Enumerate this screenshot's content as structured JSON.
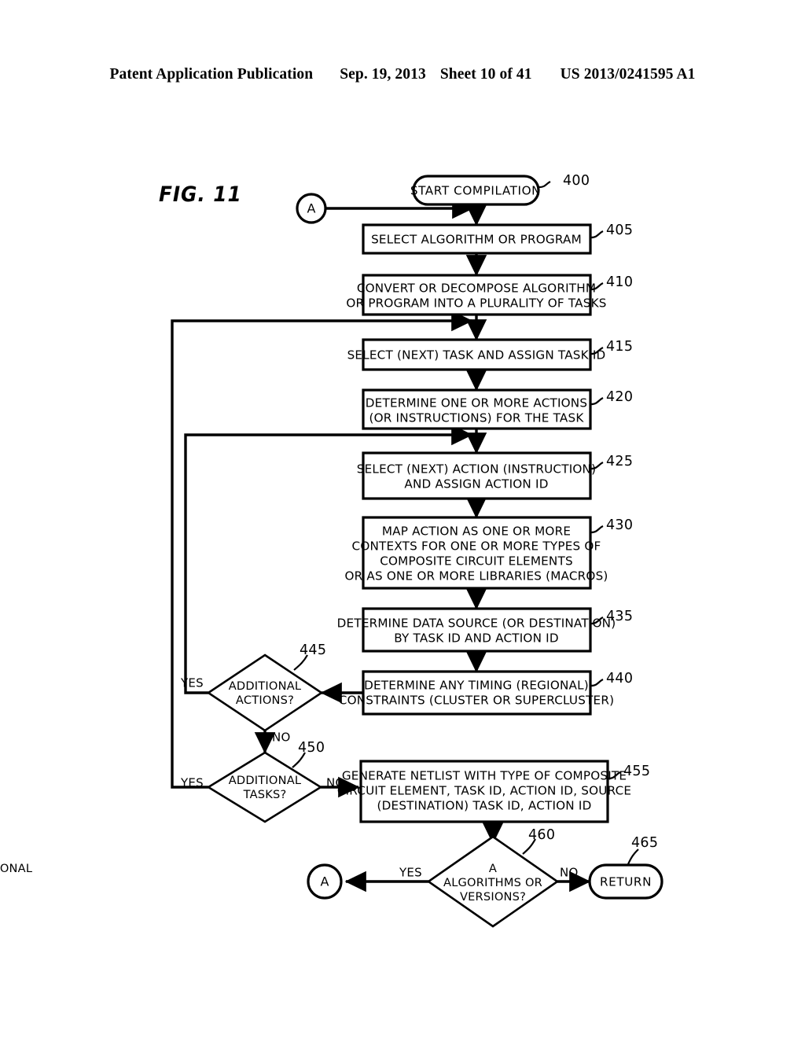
{
  "header": {
    "publication": "Patent Application Publication",
    "date": "Sep. 19, 2013",
    "sheet": "Sheet 10 of 41",
    "patent_number": "US 2013/0241595 A1"
  },
  "figure": {
    "label": "FIG. 11",
    "connector_top": "A",
    "connector_bottom": "A"
  },
  "nodes": {
    "n400": {
      "ref": "400",
      "text": "START COMPILATION"
    },
    "n405": {
      "ref": "405",
      "line1": "SELECT ALGORITHM OR PROGRAM"
    },
    "n410": {
      "ref": "410",
      "line1": "CONVERT OR DECOMPOSE ALGORITHM",
      "line2": "OR PROGRAM INTO A PLURALITY OF TASKS"
    },
    "n415": {
      "ref": "415",
      "line1": "SELECT (NEXT) TASK AND ASSIGN TASK ID"
    },
    "n420": {
      "ref": "420",
      "line1": "DETERMINE ONE OR MORE ACTIONS",
      "line2": "(OR INSTRUCTIONS) FOR THE TASK"
    },
    "n425": {
      "ref": "425",
      "line1": "SELECT (NEXT) ACTION (INSTRUCTION)",
      "line2": "AND ASSIGN ACTION ID"
    },
    "n430": {
      "ref": "430",
      "line1": "MAP ACTION AS ONE OR MORE",
      "line2": "CONTEXTS FOR ONE OR MORE TYPES OF",
      "line3": "COMPOSITE CIRCUIT ELEMENTS",
      "line4": "OR AS ONE OR MORE LIBRARIES (MACROS)"
    },
    "n435": {
      "ref": "435",
      "line1": "DETERMINE DATA SOURCE (OR DESTINATION)",
      "line2": "BY TASK ID AND ACTION ID"
    },
    "n440": {
      "ref": "440",
      "line1": "DETERMINE ANY TIMING (REGIONAL)",
      "line2": "CONSTRAINTS (CLUSTER OR SUPERCLUSTER)"
    },
    "n445": {
      "ref": "445",
      "line1": "ADDITIONAL",
      "line2": "ACTIONS?",
      "yes": "YES",
      "no": "NO"
    },
    "n450": {
      "ref": "450",
      "line1": "ADDITIONAL",
      "line2": "TASKS?",
      "yes": "YES",
      "no": "NO"
    },
    "n455": {
      "ref": "455",
      "line1": "GENERATE NETLIST WITH TYPE OF COMPOSITE",
      "line2": "CIRCUIT ELEMENT, TASK ID, ACTION ID, SOURCE",
      "line3": "(DESTINATION) TASK ID, ACTION ID"
    },
    "n460": {
      "ref": "460",
      "line1": "ADDITIONAL",
      "line2": "ALGORITHMS OR",
      "line3": "VERSIONS?",
      "yes": "YES",
      "no": "NO"
    },
    "n465": {
      "ref": "465",
      "text": "RETURN"
    }
  }
}
